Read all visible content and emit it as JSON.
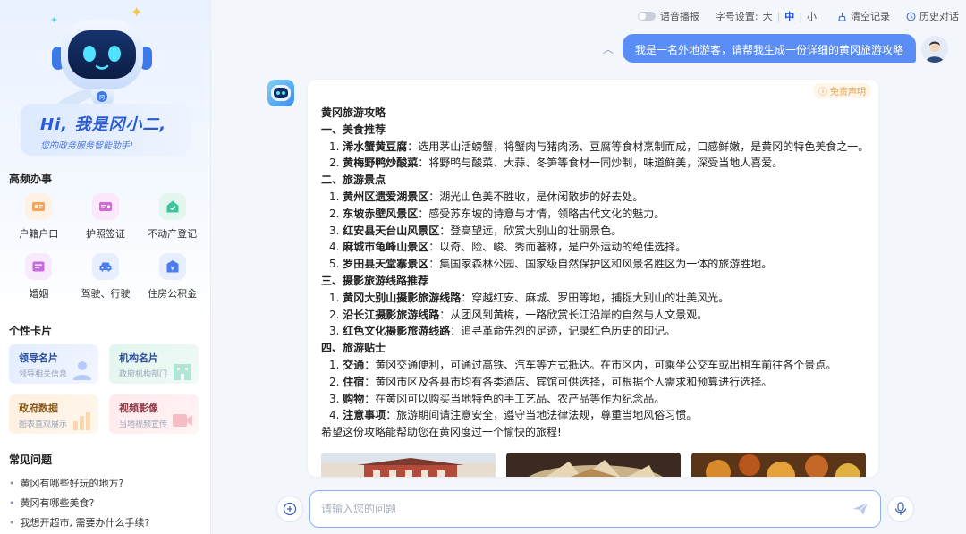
{
  "sidebar": {
    "welcome_title": "Hi, 我是冈小二,",
    "welcome_sub": "您的政务服务智能助手!",
    "frequent_title": "高频办事",
    "services": [
      {
        "label": "户籍户口",
        "icon": "id-card-icon",
        "color": "#f5a35c",
        "bg": "#fff1e3"
      },
      {
        "label": "护照签证",
        "icon": "passport-icon",
        "color": "#d26ad6",
        "bg": "#fbe9fb"
      },
      {
        "label": "不动产登记",
        "icon": "house-icon",
        "color": "#3cc49a",
        "bg": "#e3f7ef"
      },
      {
        "label": "婚姻",
        "icon": "certificate-icon",
        "color": "#c96be0",
        "bg": "#f7eafc"
      },
      {
        "label": "驾驶、行驶",
        "icon": "car-icon",
        "color": "#4a7ef0",
        "bg": "#e7efff"
      },
      {
        "label": "住房公积金",
        "icon": "fund-icon",
        "color": "#4a7ef0",
        "bg": "#e7efff"
      }
    ],
    "cards_title": "个性卡片",
    "cards": [
      {
        "title": "领导名片",
        "sub": "领导相关信息"
      },
      {
        "title": "机构名片",
        "sub": "政府机构部门"
      },
      {
        "title": "政府数据",
        "sub": "图表直观展示"
      },
      {
        "title": "视频影像",
        "sub": "当地视频宣传"
      }
    ],
    "faq_title": "常见问题",
    "faq": [
      "黄冈有哪些好玩的地方?",
      "黄冈有哪些美食?",
      "我想开超市, 需要办什么手续?"
    ]
  },
  "topbar": {
    "voice_label": "语音播报",
    "font_label": "字号设置:",
    "font_options": [
      "大",
      "中",
      "小"
    ],
    "font_selected": "中",
    "clear_label": "清空记录",
    "history_label": "历史对话"
  },
  "chat": {
    "user_message": "我是一名外地游客，请帮我生成一份详细的黄冈旅游攻略",
    "disclaimer": "免责声明",
    "answer": {
      "title": "黄冈旅游攻略",
      "sections": [
        {
          "heading": "一、美食推荐",
          "items": [
            {
              "n": "1.",
              "name": "浠水蟹黄豆腐",
              "desc": "：选用茅山活螃蟹，将蟹肉与猪肉汤、豆腐等食材烹制而成，口感鲜嫩，是黄冈的特色美食之一。"
            },
            {
              "n": "2.",
              "name": "黄梅野鸭炒酸菜",
              "desc": "：将野鸭与酸菜、大蒜、冬笋等食材一同炒制，味道鲜美，深受当地人喜爱。"
            }
          ]
        },
        {
          "heading": "二、旅游景点",
          "items": [
            {
              "n": "1.",
              "name": "黄州区遗爱湖景区",
              "desc": "：湖光山色美不胜收，是休闲散步的好去处。"
            },
            {
              "n": "2.",
              "name": "东坡赤壁风景区",
              "desc": "：感受苏东坡的诗意与才情，领略古代文化的魅力。"
            },
            {
              "n": "3.",
              "name": "红安县天台山风景区",
              "desc": "：登高望远，欣赏大别山的壮丽景色。"
            },
            {
              "n": "4.",
              "name": "麻城市龟峰山景区",
              "desc": "：以奇、险、峻、秀而著称，是户外运动的绝佳选择。"
            },
            {
              "n": "5.",
              "name": "罗田县天堂寨景区",
              "desc": "：集国家森林公园、国家级自然保护区和风景名胜区为一体的旅游胜地。"
            }
          ]
        },
        {
          "heading": "三、摄影旅游线路推荐",
          "items": [
            {
              "n": "1.",
              "name": "黄冈大别山摄影旅游线路",
              "desc": "：穿越红安、麻城、罗田等地，捕捉大别山的壮美风光。"
            },
            {
              "n": "2.",
              "name": "沿长江摄影旅游线路",
              "desc": "：从团风到黄梅，一路欣赏长江沿岸的自然与人文景观。"
            },
            {
              "n": "3.",
              "name": "红色文化摄影旅游线路",
              "desc": "：追寻革命先烈的足迹，记录红色历史的印记。"
            }
          ]
        },
        {
          "heading": "四、旅游贴士",
          "items": [
            {
              "n": "1.",
              "name": "交通",
              "desc": "：黄冈交通便利，可通过高铁、汽车等方式抵达。在市区内，可乘坐公交车或出租车前往各个景点。"
            },
            {
              "n": "2.",
              "name": "住宿",
              "desc": "：黄冈市区及各县市均有各类酒店、宾馆可供选择，可根据个人需求和预算进行选择。"
            },
            {
              "n": "3.",
              "name": "购物",
              "desc": "：在黄冈可以购买当地特色的手工艺品、农产品等作为纪念品。"
            },
            {
              "n": "4.",
              "name": "注意事项",
              "desc": "：旅游期间请注意安全，遵守当地法律法规，尊重当地风俗习惯。"
            }
          ]
        }
      ],
      "closing": "希望这份攻略能帮助您在黄冈度过一个愉快的旅程!"
    }
  },
  "input": {
    "placeholder": "请输入您的问题"
  },
  "colors": {
    "accent": "#5b8df7",
    "brand_blue": "#2a5bd7"
  }
}
